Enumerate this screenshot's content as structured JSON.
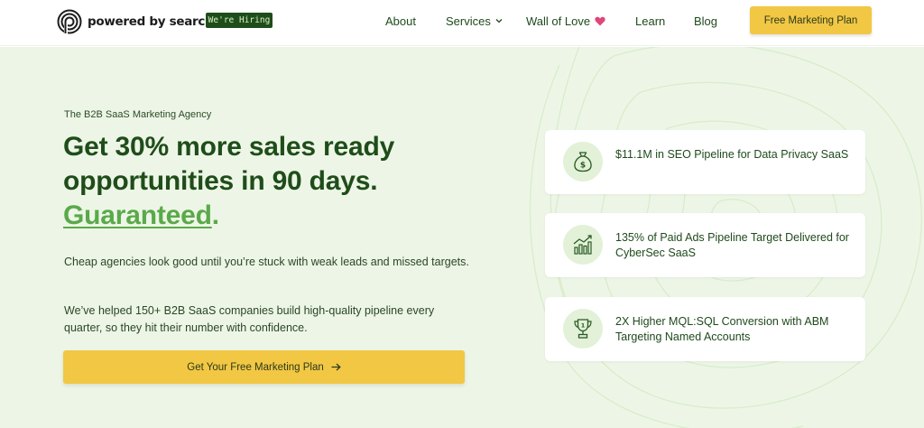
{
  "header": {
    "logo_text": "powered by search",
    "hiring_badge": "We're Hiring",
    "nav": {
      "about": "About",
      "services": "Services",
      "wall_of_love": "Wall of Love",
      "learn": "Learn",
      "blog": "Blog"
    },
    "cta": "Free Marketing Plan"
  },
  "hero": {
    "eyebrow": "The B2B SaaS Marketing Agency",
    "headline_line1": "Get 30% more sales ready",
    "headline_line2": "opportunities in 90 days.",
    "headline_guaranteed": "Guaranteed",
    "headline_period": ".",
    "para1": "Cheap agencies look good until you’re stuck with weak leads and missed targets.",
    "para2": "We’ve helped 150+ B2B SaaS companies build high-quality pipeline every quarter, so they hit their number with confidence.",
    "cta": "Get Your Free Marketing Plan"
  },
  "cards": [
    {
      "icon": "money-bag-icon",
      "text": "$11.1M in SEO Pipeline for Data Privacy SaaS"
    },
    {
      "icon": "growth-chart-icon",
      "text": "135% of Paid Ads Pipeline Target Delivered for CyberSec SaaS"
    },
    {
      "icon": "trophy-icon",
      "text": "2X Higher MQL:SQL Conversion with ABM Targeting Named Accounts"
    }
  ],
  "colors": {
    "brand_dark_green": "#1f4d1a",
    "accent_green": "#5aa94a",
    "cta_yellow": "#f2c744",
    "hero_bg": "#edf6e6",
    "heart": "#e0457b"
  }
}
